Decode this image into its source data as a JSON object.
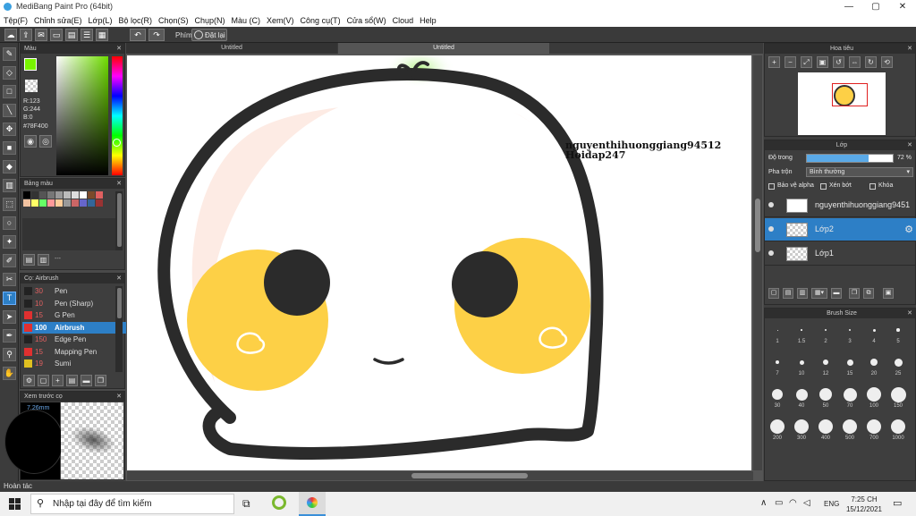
{
  "window": {
    "title": "MediBang Paint Pro (64bit)",
    "minimize": "—",
    "maximize": "▢",
    "close": "✕"
  },
  "menu": [
    "Tệp(F)",
    "Chỉnh sửa(E)",
    "Lớp(L)",
    "Bộ lọc(R)",
    "Chọn(S)",
    "Chụp(N)",
    "Màu (C)",
    "Xem(V)",
    "Công cụ(T)",
    "Cửa sổ(W)",
    "Cloud",
    "Help"
  ],
  "toolbar": {
    "phim_label": "Phím",
    "reset_label": "Đặt lại",
    "undo": "↶",
    "redo": "↷"
  },
  "color_panel": {
    "title": "Màu",
    "r": "R:123",
    "g": "G:244",
    "b": "B:0",
    "hex": "#78F400",
    "fg": "#78F400"
  },
  "swatch_panel": {
    "title": "Bảng màu",
    "dots": "---",
    "colors": [
      "#000000",
      "#333333",
      "#555555",
      "#777777",
      "#999999",
      "#bbbbbb",
      "#dddddd",
      "#ffffff",
      "#7b4a2a",
      "#e06060",
      "#f2c2a0",
      "#ffff66",
      "#66ff66",
      "#ff9999",
      "#ffcc99",
      "#999999",
      "#cc6666",
      "#6666cc",
      "#336699",
      "#993333"
    ]
  },
  "brush_panel": {
    "title": "Cọ: Airbrush",
    "brushes": [
      {
        "size": "30",
        "name": "Pen",
        "color": "#222222"
      },
      {
        "size": "10",
        "name": "Pen (Sharp)",
        "color": "#222222"
      },
      {
        "size": "15",
        "name": "G Pen",
        "color": "#e03030"
      },
      {
        "size": "100",
        "name": "Airbrush",
        "color": "#e03030",
        "selected": true
      },
      {
        "size": "150",
        "name": "Edge Pen",
        "color": "#222222"
      },
      {
        "size": "15",
        "name": "Mapping Pen",
        "color": "#e03030"
      },
      {
        "size": "19",
        "name": "Sumi",
        "color": "#e0c020"
      }
    ]
  },
  "preview_panel": {
    "title": "Xem trước cọ",
    "size": "7.26mm"
  },
  "canvas": {
    "tab1": "Untitled",
    "tab2": "Untitled",
    "text_line1": "nguyenthihuonggiang94512",
    "text_line2": "Hoidap247"
  },
  "navigator": {
    "title": "Hoa tiêu"
  },
  "layer_panel": {
    "title": "Lớp",
    "opacity_label": "Độ trong",
    "opacity_value": "72 %",
    "opacity": 0.72,
    "blend_label": "Pha trộn",
    "blend_value": "Bình thường",
    "protect_alpha": "Bảo vệ alpha",
    "clipping": "Xén bớt",
    "lock": "Khóa",
    "layers": [
      {
        "name": "nguyenthihuonggiang9451"
      },
      {
        "name": "Lớp2",
        "selected": true
      },
      {
        "name": "Lớp1"
      }
    ]
  },
  "brush_size_panel": {
    "title": "Brush Size",
    "sizes": [
      "1",
      "1.5",
      "2",
      "3",
      "4",
      "5",
      "7",
      "10",
      "12",
      "15",
      "20",
      "25",
      "30",
      "40",
      "50",
      "70",
      "100",
      "150",
      "200",
      "300",
      "400",
      "500",
      "700",
      "1000"
    ]
  },
  "status": {
    "text": "Hoàn tác"
  },
  "taskbar": {
    "search_placeholder": "Nhập tại đây để tìm kiếm",
    "time": "7:25 CH",
    "date": "15/12/2021",
    "lang": "ENG"
  }
}
